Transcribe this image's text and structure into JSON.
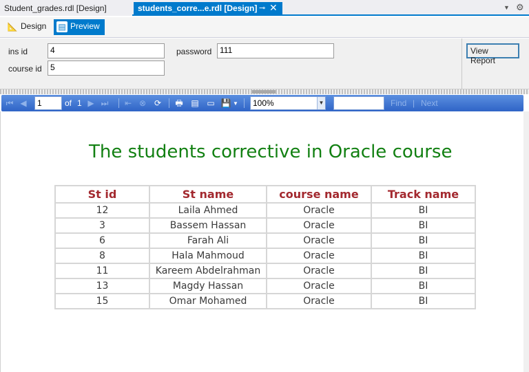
{
  "tabs": [
    {
      "label": "Student_grades.rdl [Design]",
      "active": false
    },
    {
      "label": "students_corre...e.rdl [Design]",
      "active": true
    }
  ],
  "modes": {
    "design": "Design",
    "preview": "Preview"
  },
  "params": {
    "ins_id_label": "ins id",
    "ins_id_value": "4",
    "password_label": "password",
    "password_value": "111",
    "course_id_label": "course id",
    "course_id_value": "5",
    "view_report": "View Report"
  },
  "report_toolbar": {
    "page": "1",
    "of_label": "of",
    "total_pages": "1",
    "zoom": "100%",
    "find_label": "Find",
    "next_label": "Next"
  },
  "report": {
    "title": "The students corrective in Oracle course",
    "columns": [
      "St id",
      "St name",
      "course name",
      "Track name"
    ],
    "rows": [
      [
        "12",
        "Laila Ahmed",
        "Oracle",
        "BI"
      ],
      [
        "3",
        "Bassem Hassan",
        "Oracle",
        "BI"
      ],
      [
        "6",
        "Farah Ali",
        "Oracle",
        "BI"
      ],
      [
        "8",
        "Hala Mahmoud",
        "Oracle",
        "BI"
      ],
      [
        "11",
        "Kareem Abdelrahman",
        "Oracle",
        "BI"
      ],
      [
        "13",
        "Magdy Hassan",
        "Oracle",
        "BI"
      ],
      [
        "15",
        "Omar Mohamed",
        "Oracle",
        "BI"
      ]
    ]
  },
  "colors": {
    "accent": "#007acc",
    "title": "#128012",
    "header_text": "#a3292f"
  }
}
